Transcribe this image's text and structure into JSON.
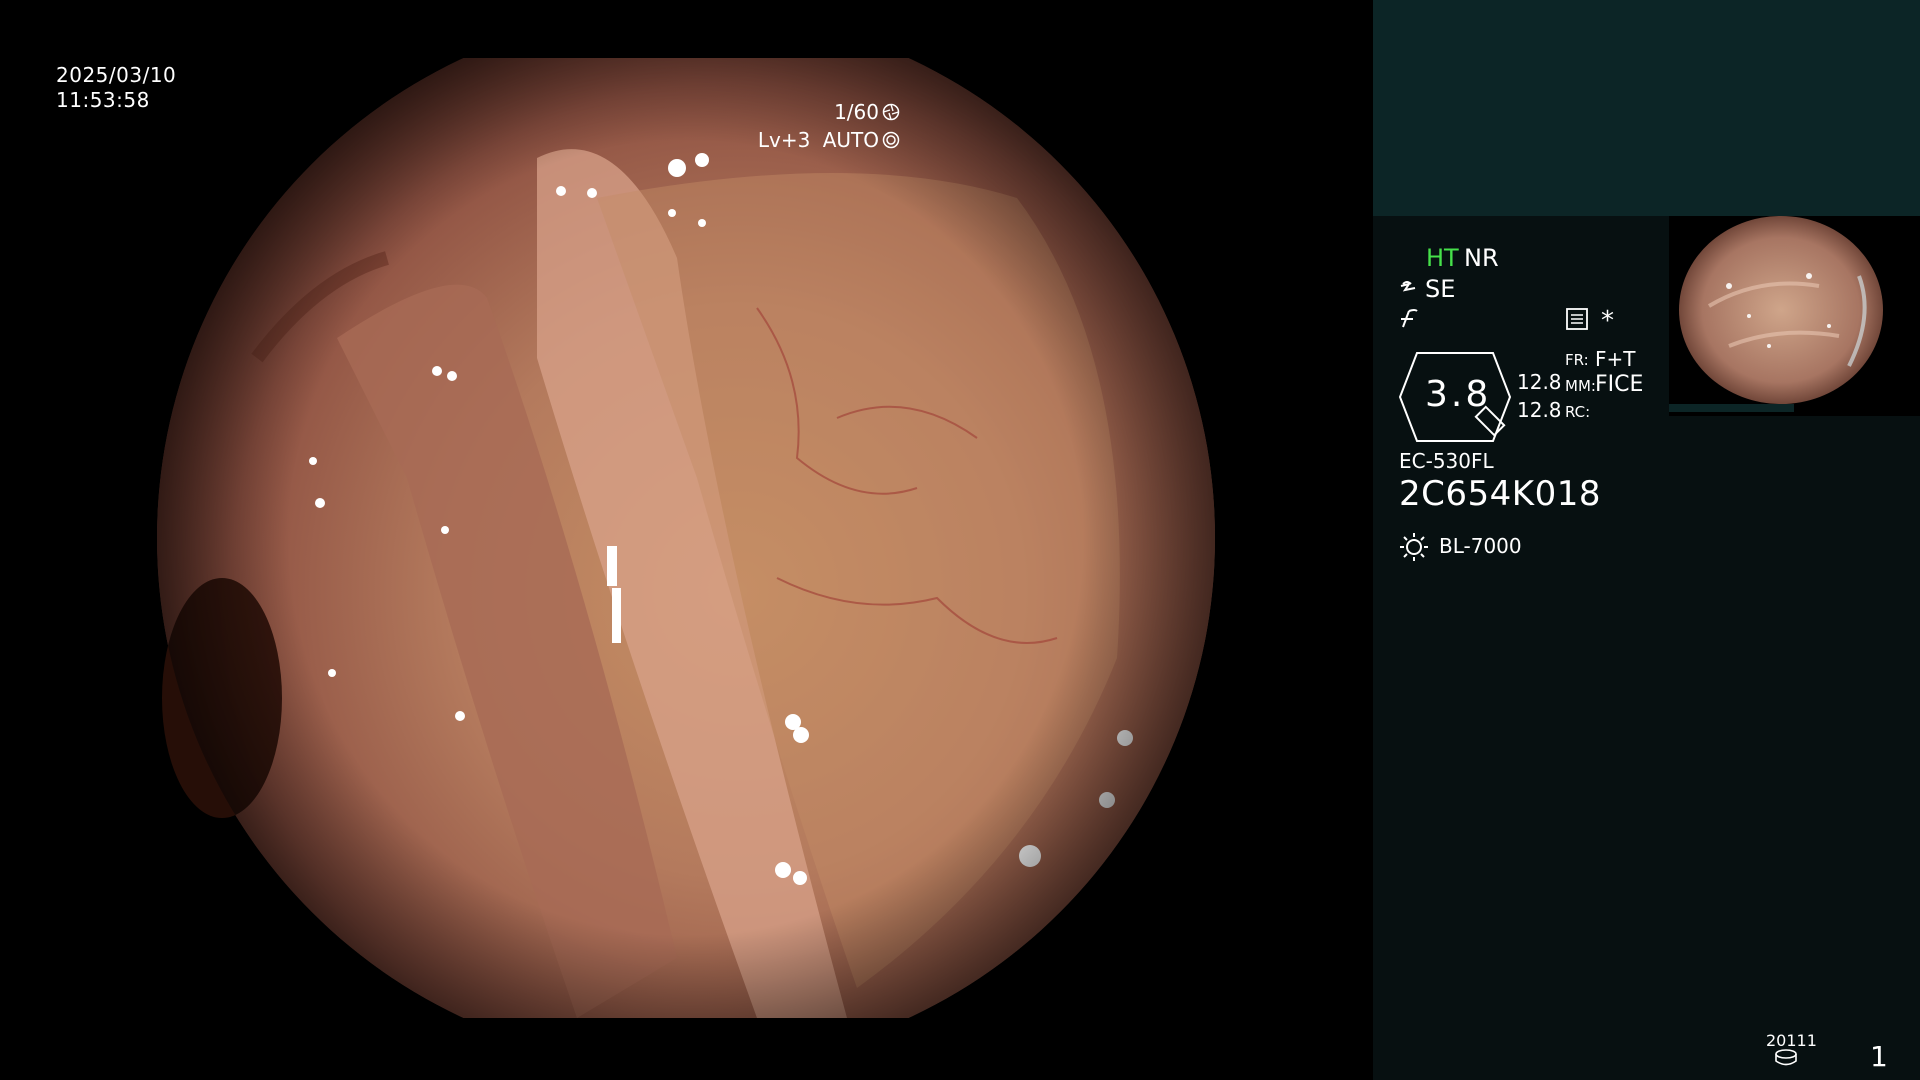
{
  "overlay": {
    "date": "2025/03/10",
    "time": "11:53:58",
    "shutter": "1/60",
    "shutter_icon": "aperture-icon",
    "level": "Lv+3",
    "mode": "AUTO",
    "mode_icon": "auto-iris-icon"
  },
  "panel": {
    "ht": "HT",
    "nr": "NR",
    "se": "SE",
    "star": "*",
    "zoom": "3.8",
    "value1": "12.8",
    "value2": "12.8",
    "fr_label": "FR:",
    "fr_value": "F+T",
    "mm_label": "MM:",
    "mm_value": "FICE",
    "rc_label": "RC:",
    "scope_model": "EC-530FL",
    "scope_serial": "2C654K018",
    "light_source": "BL-7000",
    "study_number": "20111",
    "image_count": "1"
  },
  "colors": {
    "ht_green": "#46e04a",
    "panel_bg": "#071011",
    "panel_top_bg": "#0c2526"
  }
}
